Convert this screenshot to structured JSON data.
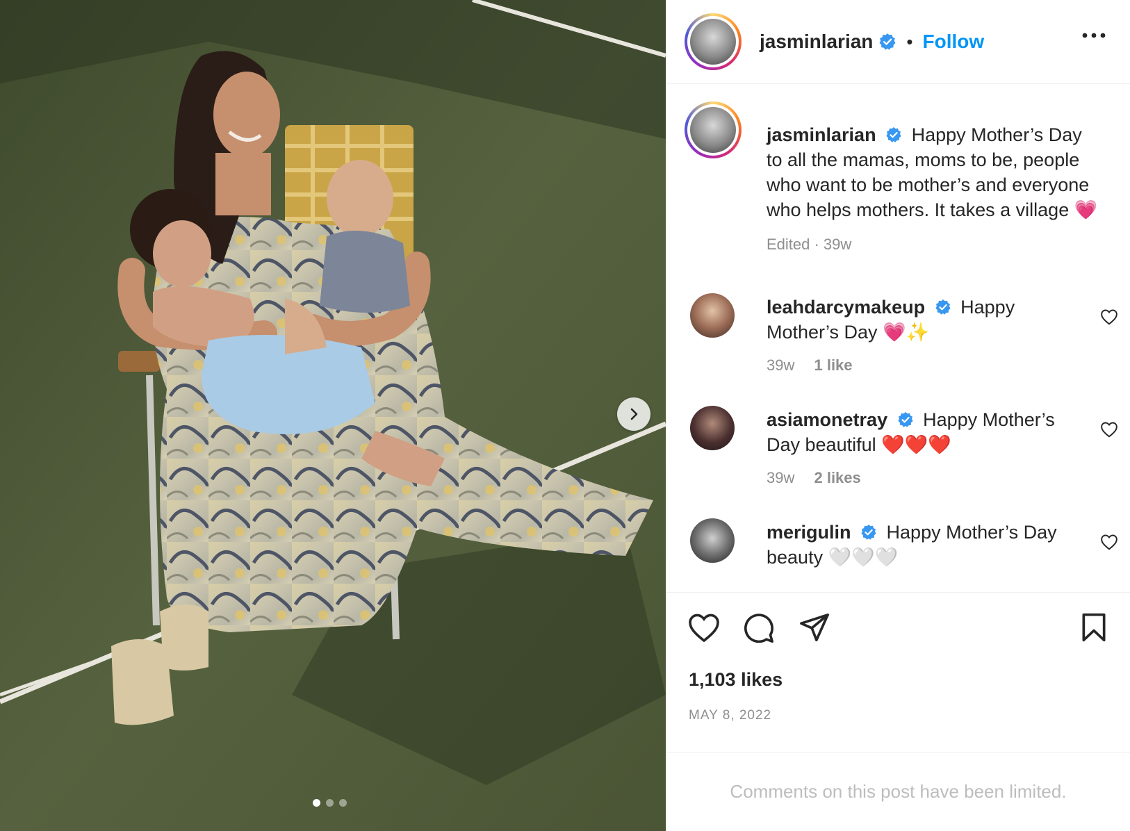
{
  "post": {
    "username": "jasminlarian",
    "follow_label": "Follow",
    "separator": "•",
    "caption": "Happy Mother’s Day to all the mamas, moms to be, people who want to be mother’s and everyone who helps mothers. It takes a village 💗",
    "caption_meta": "Edited · 39w",
    "likes": "1,103 likes",
    "date": "MAY 8, 2022",
    "comments_limited": "Comments on this post have been limited."
  },
  "comments": [
    {
      "username": "leahdarcymakeup",
      "text": "Happy Mother’s Day 💗✨",
      "age": "39w",
      "likes": "1 like"
    },
    {
      "username": "asiamonetray",
      "text": "Happy Mother’s Day beautiful ❤️❤️❤️",
      "age": "39w",
      "likes": "2 likes"
    },
    {
      "username": "merigulin",
      "text": "Happy Mother’s Day beauty 🤍🤍🤍",
      "age": "",
      "likes": ""
    }
  ],
  "carousel": {
    "current": 1,
    "total": 3
  },
  "icons": {
    "verified": "verified-badge-icon",
    "more": "more-options-icon",
    "like": "heart-icon",
    "comment": "comment-bubble-icon",
    "share": "paper-plane-icon",
    "save": "bookmark-icon",
    "next": "chevron-right-icon"
  },
  "colors": {
    "accent": "#0095f6",
    "verified": "#3897f0",
    "muted": "#8e8e8e"
  }
}
